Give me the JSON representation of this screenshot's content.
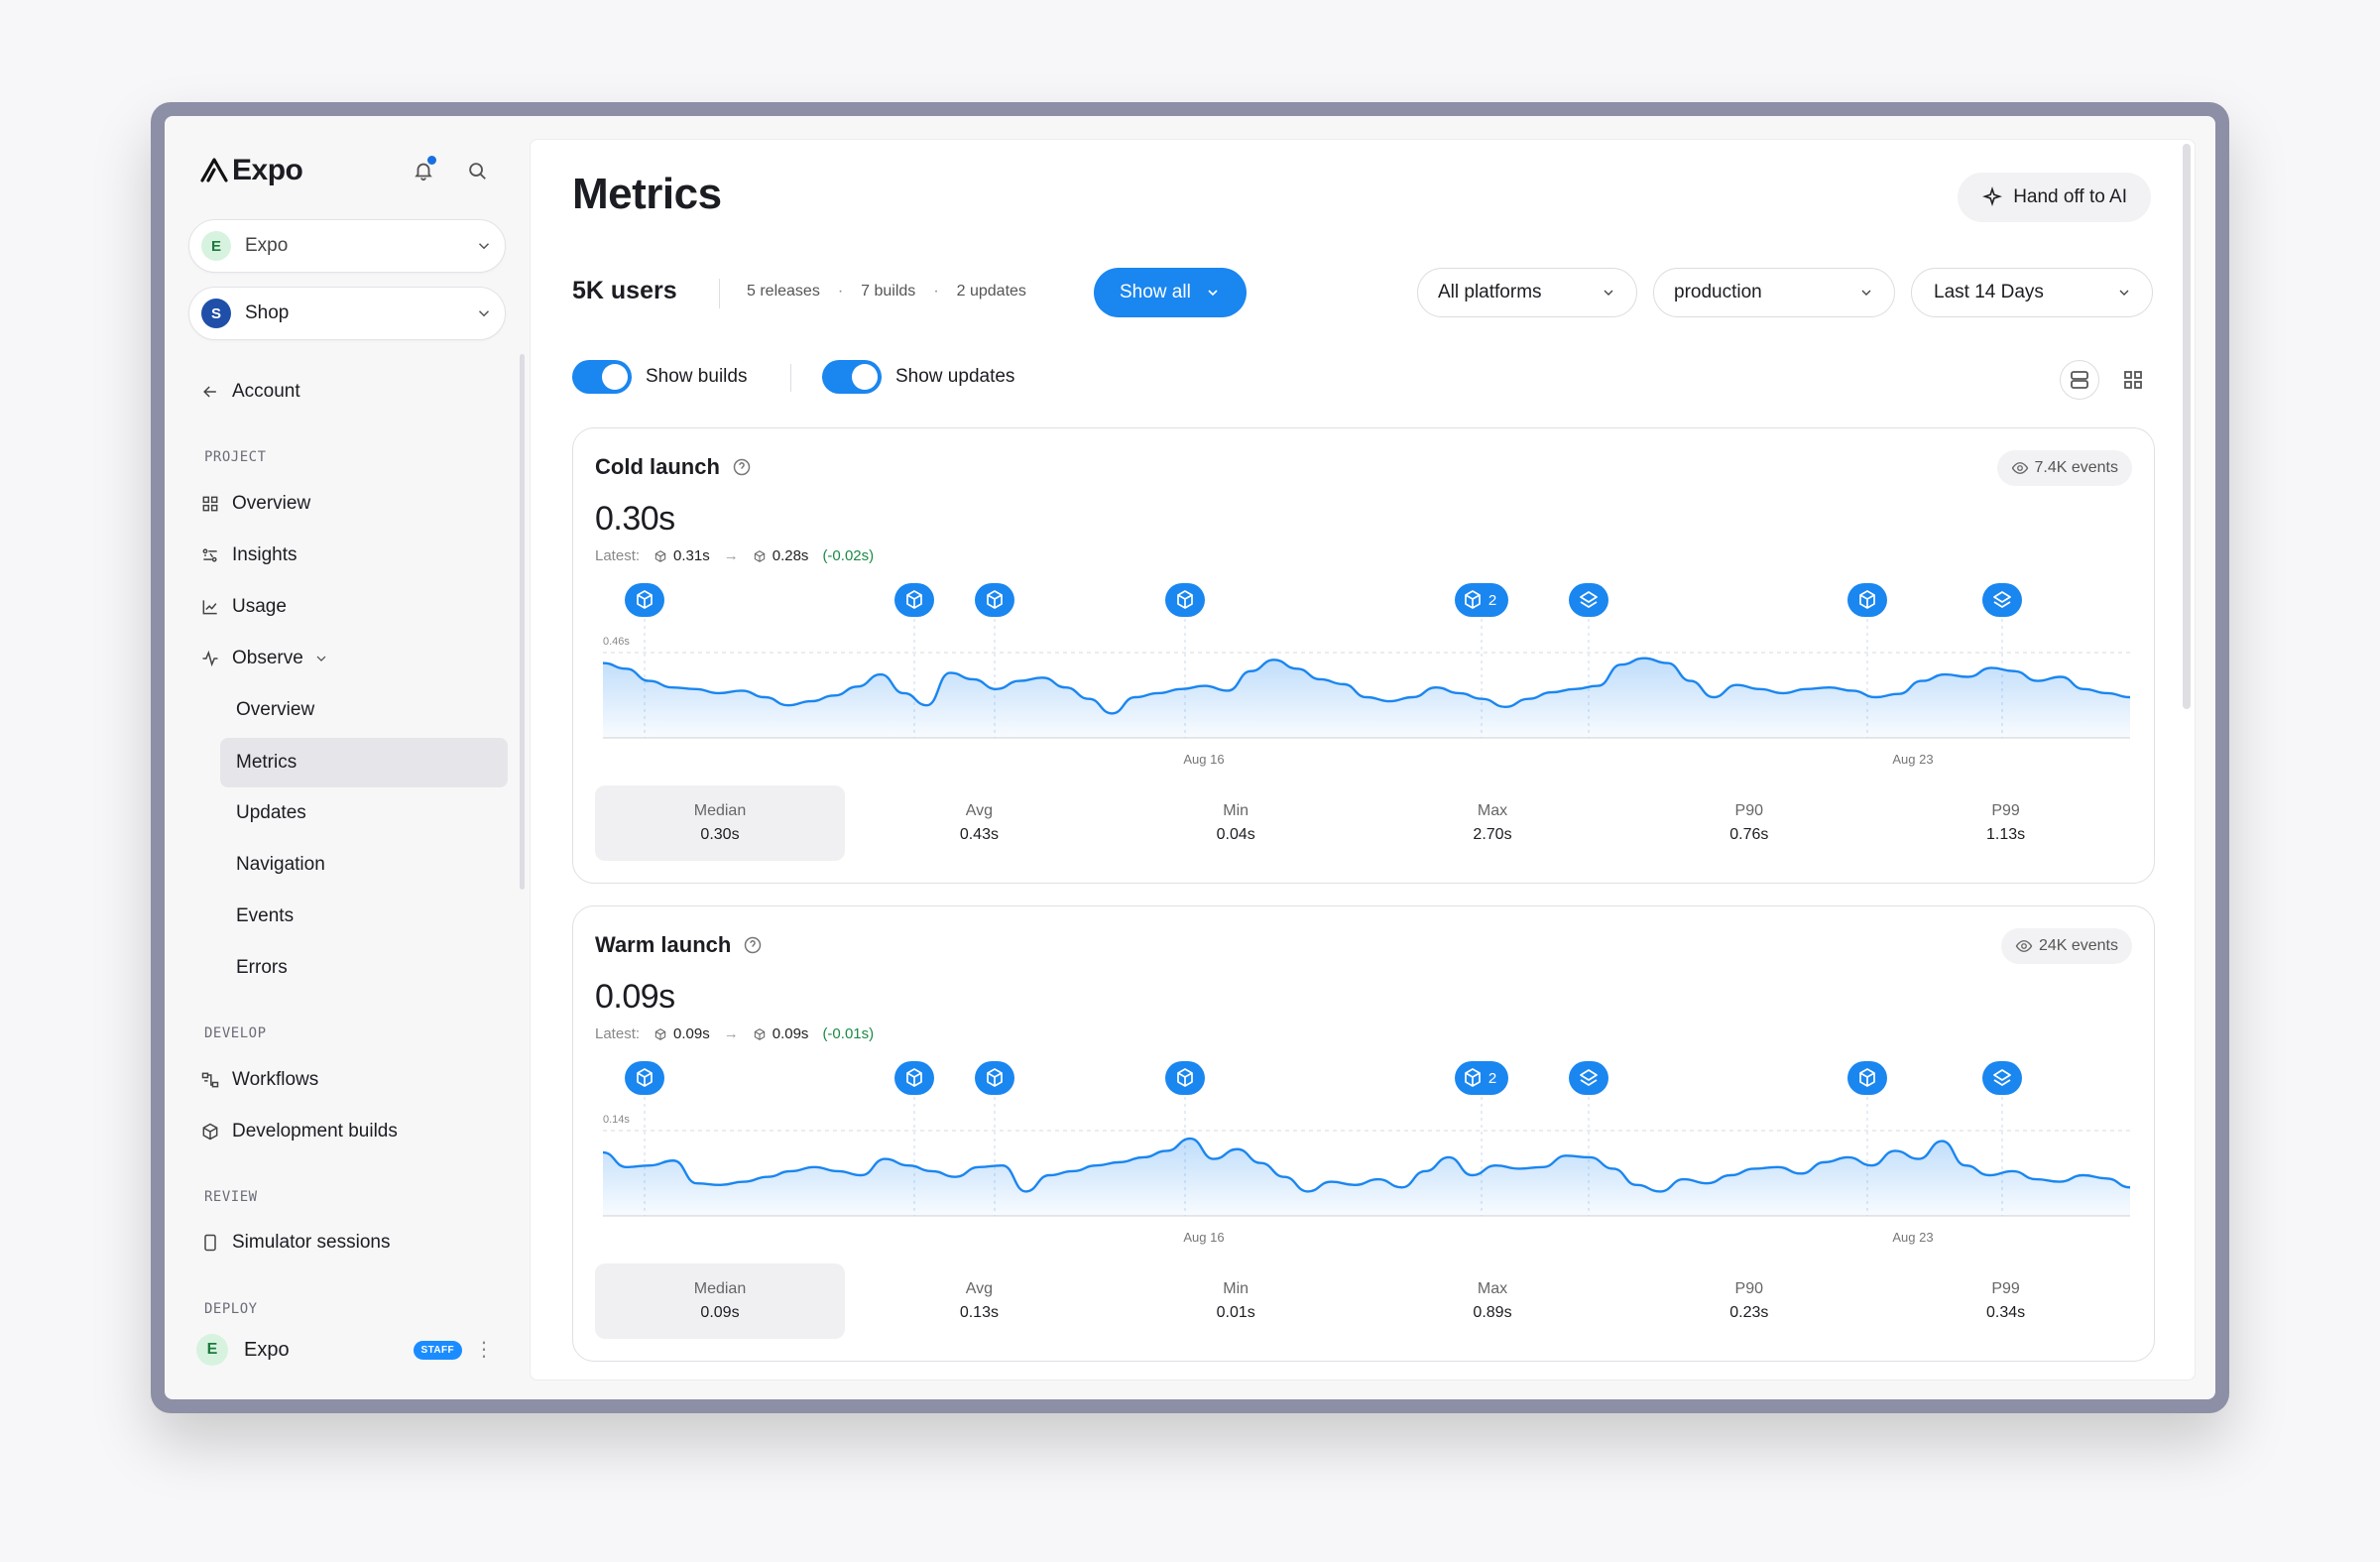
{
  "brand": "Expo",
  "sidebar": {
    "org_picker": {
      "badge": "E",
      "label": "Expo"
    },
    "project_picker": {
      "badge": "S",
      "label": "Shop"
    },
    "account": "Account",
    "project_label": "PROJECT",
    "items": [
      "Overview",
      "Insights",
      "Usage",
      "Observe"
    ],
    "observe_sub": [
      "Overview",
      "Metrics",
      "Updates",
      "Navigation",
      "Events",
      "Errors"
    ],
    "develop_label": "DEVELOP",
    "develop_items": [
      "Workflows",
      "Development builds"
    ],
    "review_label": "REVIEW",
    "review_items": [
      "Simulator sessions"
    ],
    "deploy_label": "DEPLOY",
    "footer": {
      "badge": "E",
      "label": "Expo",
      "tag": "STAFF"
    }
  },
  "header": {
    "title": "Metrics",
    "handoff": "Hand off to AI",
    "users": "5K users",
    "releases": "5 releases",
    "builds": "7 builds",
    "updates": "2 updates",
    "show_all": "Show all",
    "platform": "All platforms",
    "channel": "production",
    "range": "Last 14 Days",
    "show_builds": "Show builds",
    "show_updates": "Show updates"
  },
  "colors": {
    "accent": "#1a86f0",
    "positive": "#1c8a45",
    "line": "#1a86f0"
  },
  "cards": [
    {
      "title": "Cold launch",
      "events": "7.4K events",
      "value": "0.30s",
      "latest_label": "Latest:",
      "from": "0.31s",
      "to": "0.28s",
      "delta": "(-0.02s)",
      "ymax_label": "0.46s",
      "xlabels": [
        "Aug 16",
        "Aug 23"
      ],
      "metrics": [
        {
          "label": "Median",
          "value": "0.30s"
        },
        {
          "label": "Avg",
          "value": "0.43s"
        },
        {
          "label": "Min",
          "value": "0.04s"
        },
        {
          "label": "Max",
          "value": "2.70s"
        },
        {
          "label": "P90",
          "value": "0.76s"
        },
        {
          "label": "P99",
          "value": "1.13s"
        }
      ]
    },
    {
      "title": "Warm launch",
      "events": "24K events",
      "value": "0.09s",
      "latest_label": "Latest:",
      "from": "0.09s",
      "to": "0.09s",
      "delta": "(-0.01s)",
      "ymax_label": "0.14s",
      "xlabels": [
        "Aug 16",
        "Aug 23"
      ],
      "metrics": [
        {
          "label": "Median",
          "value": "0.09s"
        },
        {
          "label": "Avg",
          "value": "0.13s"
        },
        {
          "label": "Min",
          "value": "0.01s"
        },
        {
          "label": "Max",
          "value": "0.89s"
        },
        {
          "label": "P90",
          "value": "0.23s"
        },
        {
          "label": "P99",
          "value": "0.34s"
        }
      ]
    }
  ],
  "markers": [
    {
      "kind": "build",
      "label": ""
    },
    {
      "kind": "build",
      "label": ""
    },
    {
      "kind": "build",
      "label": ""
    },
    {
      "kind": "build",
      "label": ""
    },
    {
      "kind": "build",
      "label": "2"
    },
    {
      "kind": "update",
      "label": ""
    },
    {
      "kind": "build",
      "label": ""
    },
    {
      "kind": "update",
      "label": ""
    }
  ]
}
